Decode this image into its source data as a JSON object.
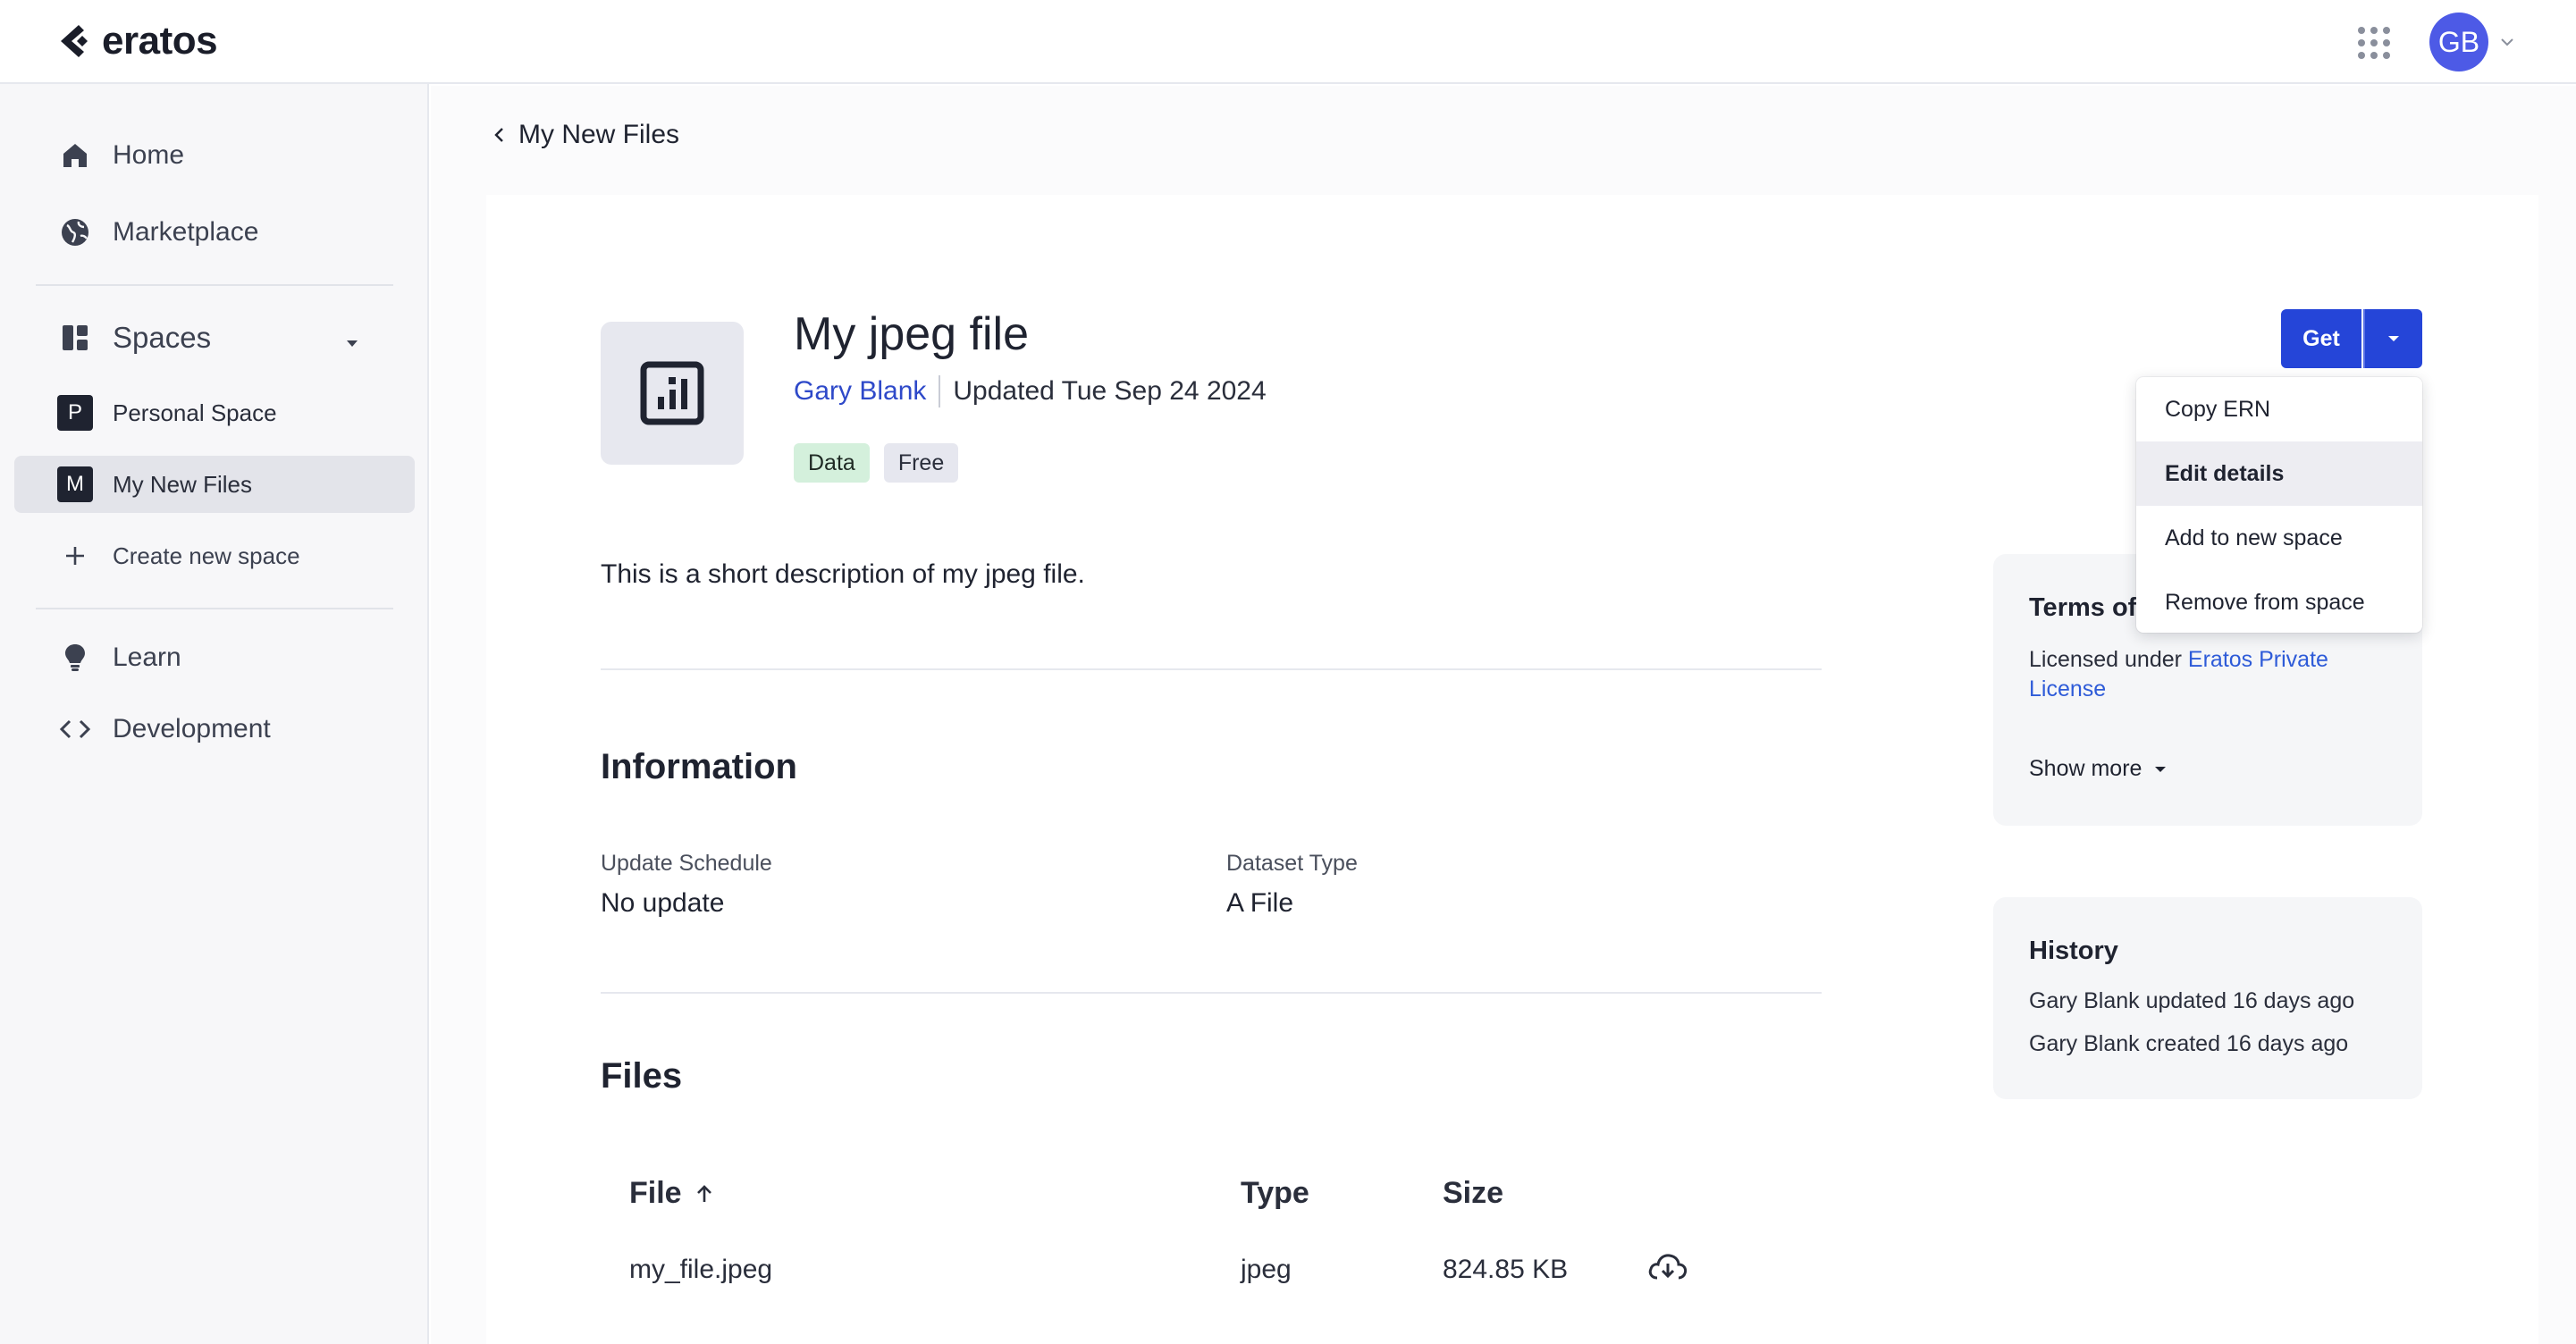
{
  "app": {
    "brand": "eratos",
    "user_initials": "GB"
  },
  "sidebar": {
    "home": "Home",
    "marketplace": "Marketplace",
    "spaces": "Spaces",
    "personal_space": {
      "badge": "P",
      "label": "Personal Space"
    },
    "my_new_files": {
      "badge": "M",
      "label": "My New Files"
    },
    "create_space": "Create new space",
    "learn": "Learn",
    "development": "Development"
  },
  "breadcrumb": {
    "back_label": "My New Files"
  },
  "dataset": {
    "title": "My jpeg file",
    "author": "Gary Blank",
    "updated": "Updated Tue Sep 24 2024",
    "tags": [
      "Data",
      "Free"
    ],
    "description": "This is a short description of my jpeg file."
  },
  "information": {
    "heading": "Information",
    "update_schedule_label": "Update Schedule",
    "update_schedule_value": "No update",
    "dataset_type_label": "Dataset Type",
    "dataset_type_value": "A File"
  },
  "files": {
    "heading": "Files",
    "columns": [
      "File",
      "Type",
      "Size"
    ],
    "rows": [
      {
        "file": "my_file.jpeg",
        "type": "jpeg",
        "size": "824.85 KB"
      }
    ]
  },
  "actions": {
    "get_label": "Get",
    "menu": [
      "Copy ERN",
      "Edit details",
      "Add to new space",
      "Remove from space"
    ]
  },
  "terms": {
    "title": "Terms of",
    "licensed_under": "Licensed under",
    "license_line1": "Eratos Private",
    "license_line2": "License",
    "show_more": "Show more"
  },
  "history": {
    "title": "History",
    "entries": [
      "Gary Blank updated 16 days ago",
      "Gary Blank created 16 days ago"
    ]
  },
  "colors": {
    "accent": "#2545d8",
    "link": "#2e49c9",
    "avatar": "#4d5ae6",
    "tag_data": "#d4f0dc"
  }
}
